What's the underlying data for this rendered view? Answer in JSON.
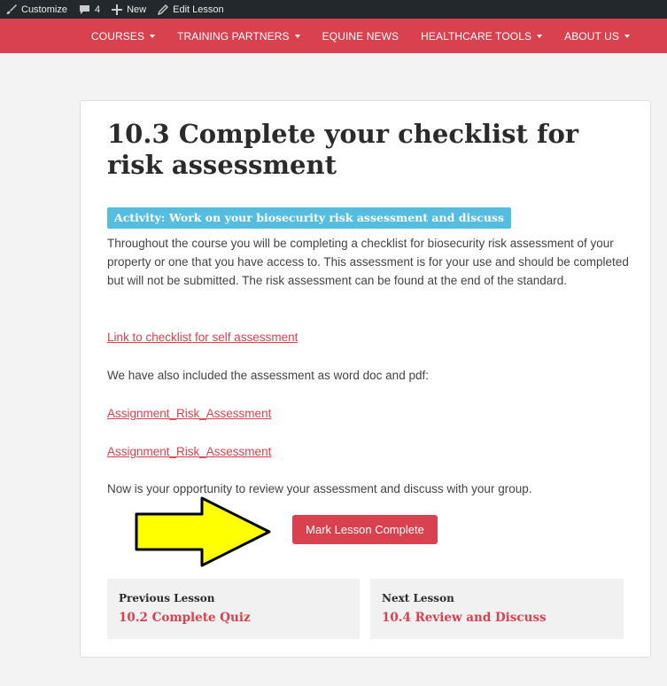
{
  "admin_bar": {
    "items": [
      {
        "label": "Customize",
        "icon": "paintbrush-icon"
      },
      {
        "label": "4",
        "icon": "comment-icon"
      },
      {
        "label": "New",
        "icon": "plus-icon"
      },
      {
        "label": "Edit Lesson",
        "icon": "pencil-icon"
      }
    ]
  },
  "nav": {
    "items": [
      {
        "label": "COURSES"
      },
      {
        "label": "TRAINING PARTNERS"
      },
      {
        "label": "EQUINE NEWS"
      },
      {
        "label": "HEALTHCARE TOOLS"
      },
      {
        "label": "ABOUT US"
      }
    ]
  },
  "lesson": {
    "title": "10.3 Complete your checklist for risk assessment",
    "activity_label": "Activity: Work on your biosecurity risk assessment and discuss",
    "intro": "Throughout the course you will be completing a checklist for biosecurity risk assessment of your property or one that you have access to.  This assessment is for your use and should be completed but will not be submitted.  The risk assessment can be found at the end of the standard.",
    "link_checklist": "Link to checklist for self assessment",
    "included_text": "We have also included the assessment as word doc and pdf:",
    "link_word": "Assignment_Risk_Assessment",
    "link_pdf": "Assignment_Risk_Assessment",
    "now_text": "Now is your opportunity to review your assessment and discuss with your group.",
    "mark_complete": "Mark Lesson Complete"
  },
  "lesson_nav": {
    "previous_label": "Previous Lesson",
    "previous_title": "10.2 Complete Quiz",
    "next_label": "Next Lesson",
    "next_title": "10.4 Review and Discuss"
  },
  "colors": {
    "brand": "#d9414f",
    "activity": "#54bde0",
    "admin_bar": "#23282d",
    "arrow_fill": "#ffff00"
  }
}
